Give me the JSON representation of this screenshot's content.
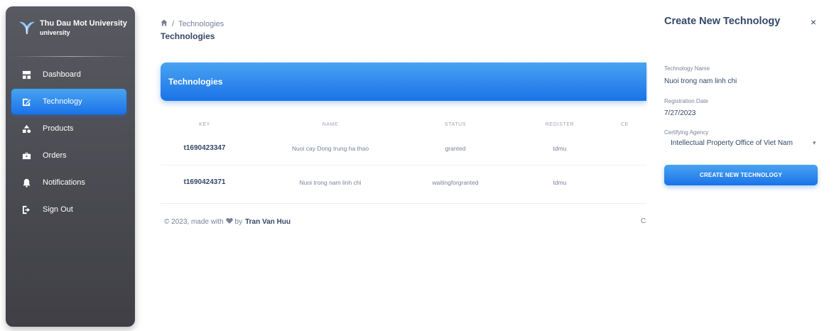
{
  "brand": {
    "name": "Thu Dau Mot University",
    "subtitle": "university"
  },
  "sidebar": {
    "items": [
      {
        "label": "Dashboard",
        "icon": "dashboard-icon"
      },
      {
        "label": "Technology",
        "icon": "edit-note-icon",
        "active": true
      },
      {
        "label": "Products",
        "icon": "shapes-icon"
      },
      {
        "label": "Orders",
        "icon": "briefcase-icon"
      },
      {
        "label": "Notifications",
        "icon": "bell-icon"
      },
      {
        "label": "Sign Out",
        "icon": "logout-icon"
      }
    ]
  },
  "breadcrumb": {
    "current": "Technologies",
    "separator": "/"
  },
  "page_title": "Technologies",
  "card": {
    "title": "Technologies"
  },
  "table": {
    "headers": [
      "KEY",
      "NAME",
      "STATUS",
      "REGISTER",
      "CE"
    ],
    "rows": [
      {
        "key": "t1690423347",
        "name": "Nuoi cay Dong trung ha thao",
        "status": "granted",
        "register": "tdmu"
      },
      {
        "key": "t1690424371",
        "name": "Nuoi trong nam linh chi",
        "status": "waitingforgranted",
        "register": "tdmu"
      }
    ]
  },
  "footer": {
    "prefix": "© 2023, made with",
    "by": "by",
    "author": "Tran Van Huu",
    "edge": "C"
  },
  "panel": {
    "title": "Create New Technology",
    "close": "×",
    "fields": {
      "name_label": "Technology Name",
      "name_value": "Nuoi trong nam linh chi",
      "date_label": "Registration Date",
      "date_value": "7/27/2023",
      "agency_label": "Certifying Agency",
      "agency_value": "Intellectual Property Office of Viet Nam"
    },
    "submit_label": "CREATE NEW TECHNOLOGY"
  },
  "colors": {
    "accent": "#1a73e8",
    "accent_light": "#49a3f1",
    "sidebar": "#4a4a50",
    "text": "#344767",
    "muted": "#7b809a"
  }
}
